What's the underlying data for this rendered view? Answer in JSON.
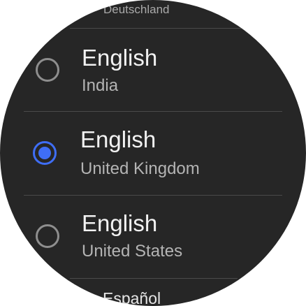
{
  "languages": [
    {
      "name": "",
      "region": "Deutschland",
      "selected": false
    },
    {
      "name": "English",
      "region": "India",
      "selected": false
    },
    {
      "name": "English",
      "region": "United Kingdom",
      "selected": true
    },
    {
      "name": "English",
      "region": "United States",
      "selected": false
    },
    {
      "name": "Español",
      "region": "",
      "selected": false
    }
  ],
  "colors": {
    "background": "#262626",
    "accent": "#3f6ef6",
    "divider": "#4a4a4a"
  }
}
